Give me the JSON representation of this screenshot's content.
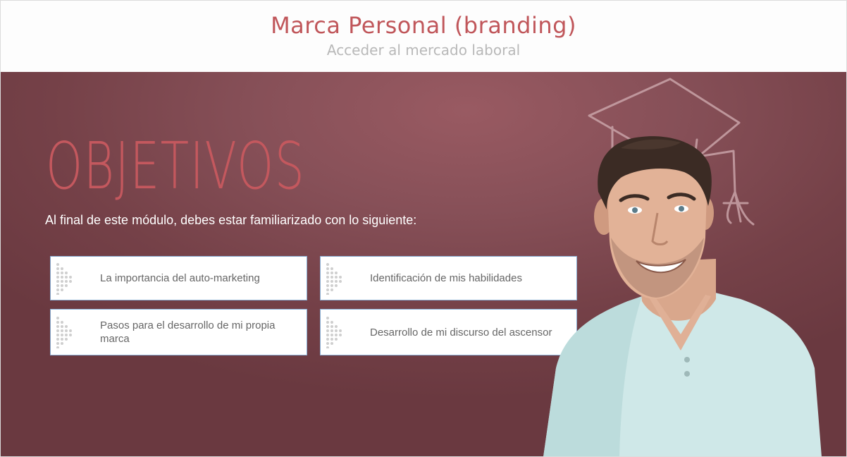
{
  "header": {
    "title": "Marca Personal (branding)",
    "subtitle": "Acceder al mercado laboral"
  },
  "main": {
    "heading": "OBJETIVOS",
    "intro": "Al final de este módulo, debes estar familiarizado con lo siguiente:",
    "objectives": [
      {
        "label": "La importancia del auto-marketing",
        "icon": "dotted-arrow-icon"
      },
      {
        "label": "Identificación de mis habilidades",
        "icon": "dotted-arrow-icon"
      },
      {
        "label": "Pasos para el desarrollo de mi propia marca",
        "icon": "dotted-arrow-icon"
      },
      {
        "label": "Desarrollo de mi discurso del ascensor",
        "icon": "dotted-arrow-icon"
      }
    ]
  },
  "colors": {
    "accent": "#c0565a",
    "background": "#7f4a52",
    "card_border": "#8ab0d6"
  }
}
